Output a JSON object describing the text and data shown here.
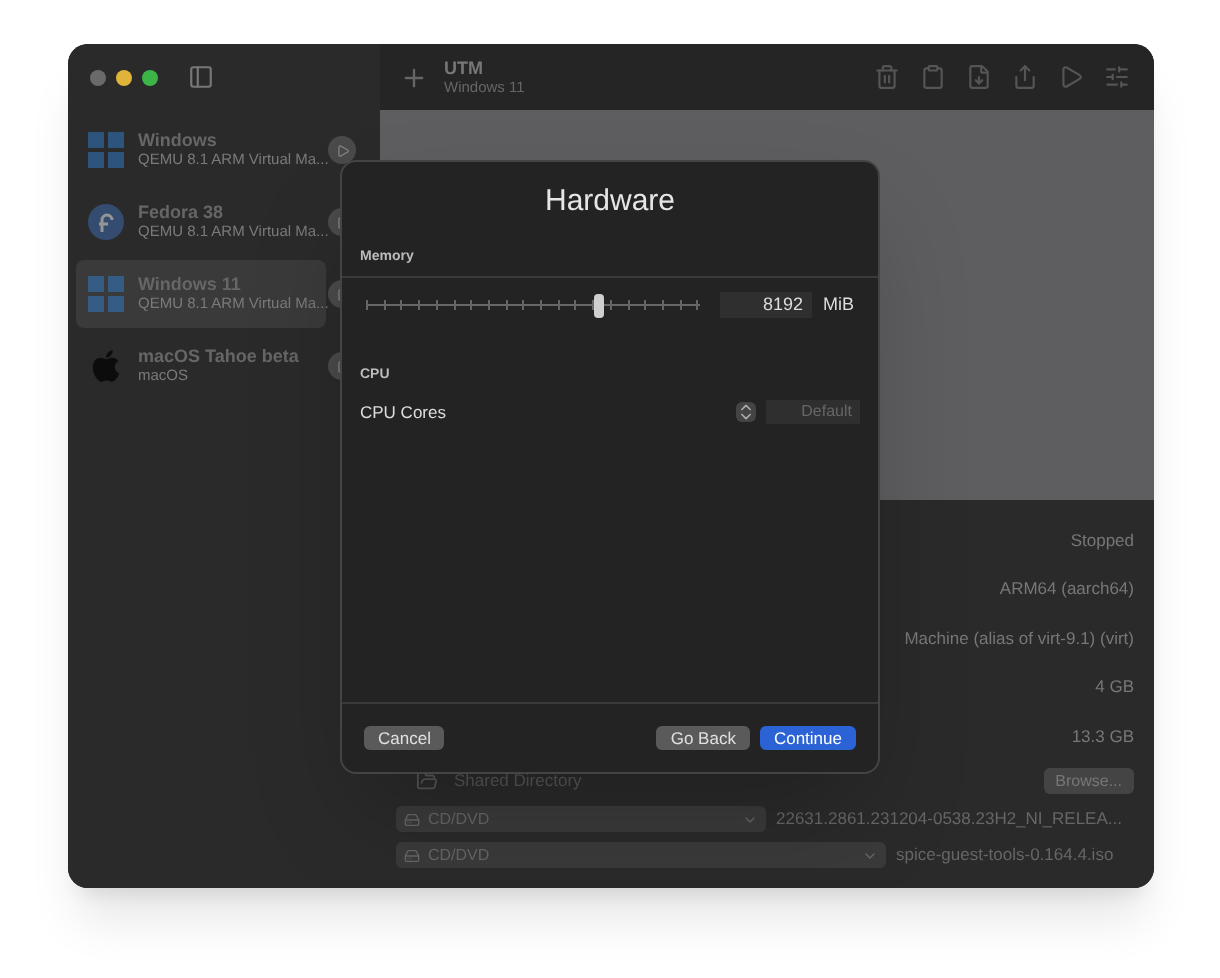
{
  "window": {
    "title": "UTM",
    "subtitle": "Windows 11"
  },
  "sidebar": {
    "items": [
      {
        "name": "Windows",
        "detail": "QEMU 8.1 ARM Virtual Ma...",
        "kind": "windows",
        "selected": false
      },
      {
        "name": "Fedora 38",
        "detail": "QEMU 8.1 ARM Virtual Ma...",
        "kind": "fedora",
        "selected": false
      },
      {
        "name": "Windows 11",
        "detail": "QEMU 8.1 ARM Virtual Ma...",
        "kind": "windows",
        "selected": true
      },
      {
        "name": "macOS Tahoe beta",
        "detail": "macOS",
        "kind": "apple",
        "selected": false
      }
    ]
  },
  "details": {
    "rows": [
      {
        "value": "Stopped"
      },
      {
        "value": "ARM64 (aarch64)"
      },
      {
        "value": "Machine (alias of virt-9.1) (virt)"
      },
      {
        "value": "4 GB"
      },
      {
        "value": "13.3 GB"
      }
    ],
    "shared_directory": {
      "label": "Shared Directory",
      "button": "Browse..."
    },
    "drives": [
      {
        "label": "CD/DVD",
        "value": "22631.2861.231204-0538.23H2_NI_RELEA..."
      },
      {
        "label": "CD/DVD",
        "value": "spice-guest-tools-0.164.4.iso"
      }
    ]
  },
  "dialog": {
    "title": "Hardware",
    "memory": {
      "label": "Memory",
      "level": 0.7,
      "value": "8192",
      "unit": "MiB"
    },
    "cpu": {
      "label": "CPU",
      "cores_label": "CPU Cores",
      "cores_placeholder": "Default"
    },
    "buttons": [
      {
        "label": "Cancel",
        "kind": "secondary"
      },
      {
        "label": "Go Back",
        "kind": "secondary"
      },
      {
        "label": "Continue",
        "kind": "primary"
      }
    ]
  }
}
